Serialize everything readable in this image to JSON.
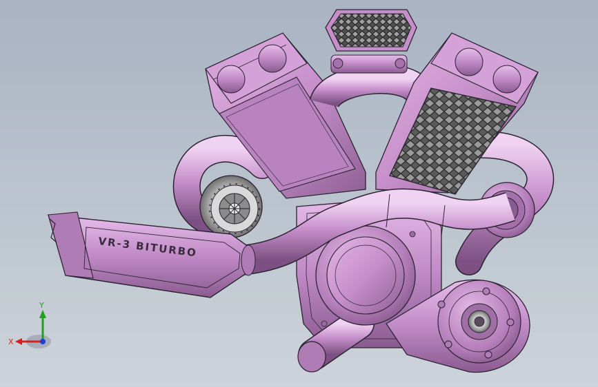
{
  "model": {
    "muffler_text": "VR-3 BITURBO",
    "body_color": "#c68fca",
    "body_shade": "#9a6aa0",
    "edge_color": "#2a2230",
    "mesh_color": "#4a4a4a"
  },
  "triad": {
    "x_label": "X",
    "y_label": "Y",
    "x_color": "#d42020",
    "y_color": "#20a020",
    "z_color": "#2040d0"
  }
}
